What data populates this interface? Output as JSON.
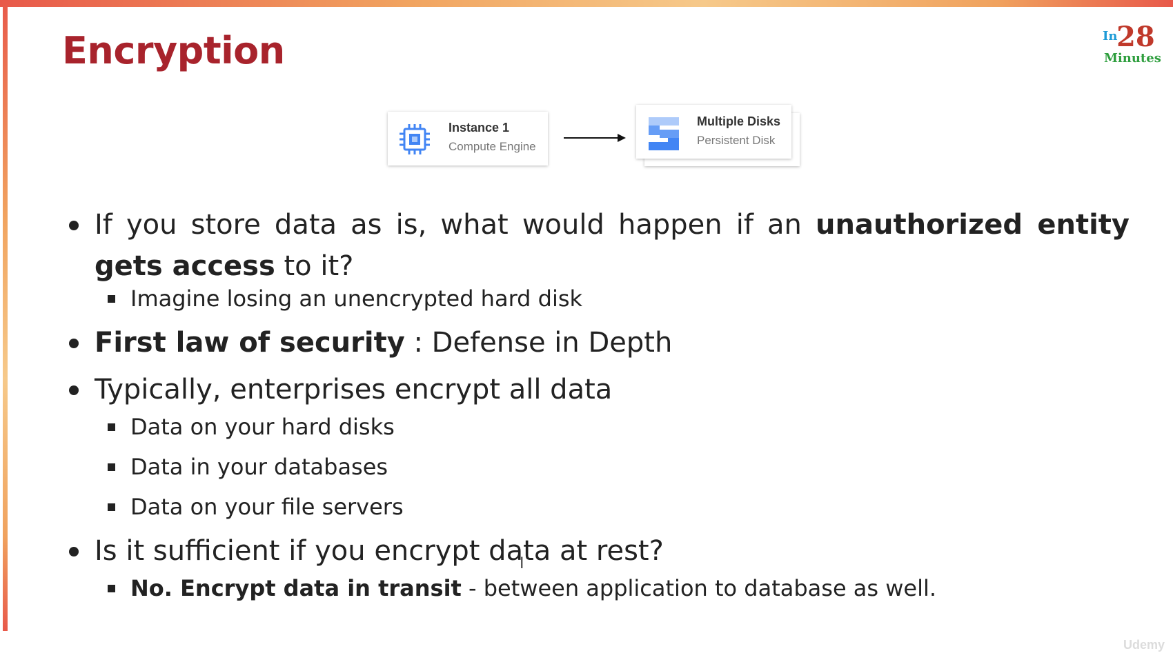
{
  "slide": {
    "title": "Encryption"
  },
  "logo": {
    "in": "In",
    "number": "28",
    "minutes": "Minutes"
  },
  "diagram": {
    "instance": {
      "name": "Instance 1",
      "service": "Compute Engine",
      "icon": "compute-engine-chip-icon"
    },
    "disks": {
      "name": "Multiple Disks",
      "service": "Persistent Disk",
      "icon": "persistent-disk-icon"
    },
    "connector": "arrow-right"
  },
  "bullets": {
    "q1": {
      "prefix": "If you store data as is, what would happen if an ",
      "bold": "unauthorized entity gets access",
      "suffix": " to it?",
      "sub1": "Imagine losing an unencrypted hard disk"
    },
    "law": {
      "bold": "First law of security",
      "rest": " : Defense in Depth"
    },
    "enterprises": {
      "text": "Typically, enterprises encrypt all data",
      "subs": [
        "Data on your hard disks",
        "Data in your databases",
        "Data on your file servers"
      ]
    },
    "rest": {
      "text": "Is it sufficient if you encrypt data at rest?",
      "sub_bold": "No. Encrypt data in transit",
      "sub_rest": " - between application to database as well."
    }
  },
  "watermark": "Udemy",
  "colors": {
    "title": "#a8232c",
    "border_red": "#e8594a",
    "border_orange": "#f1a460",
    "gcp_blue": "#4285f4"
  }
}
